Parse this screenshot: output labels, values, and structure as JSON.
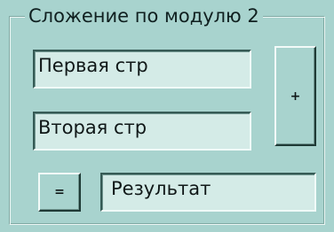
{
  "group": {
    "title": "Сложение по модулю 2"
  },
  "inputs": {
    "first": "Первая стр",
    "second": "Вторая стр",
    "result": "Результат"
  },
  "buttons": {
    "plus_label": "+",
    "equals_label": "="
  }
}
